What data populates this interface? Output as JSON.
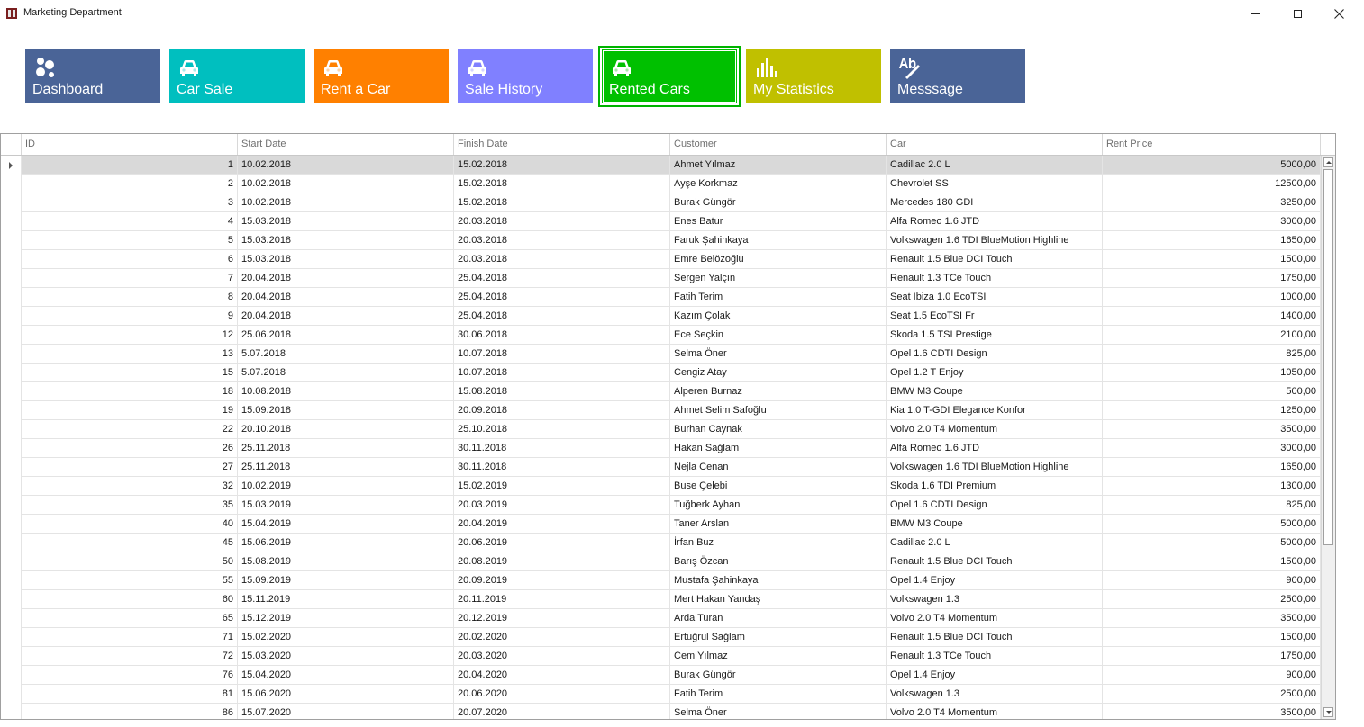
{
  "window": {
    "title": "Marketing Department",
    "controls": [
      "minimize",
      "maximize",
      "close"
    ]
  },
  "tiles": [
    {
      "label": "Dashboard",
      "icon": "bubbles-icon",
      "color": "#4a6497",
      "selected": false
    },
    {
      "label": "Car Sale",
      "icon": "car-icon",
      "color": "#00bfbf",
      "selected": false
    },
    {
      "label": "Rent a Car",
      "icon": "car-icon",
      "color": "#ff8000",
      "selected": false
    },
    {
      "label": "Sale History",
      "icon": "car-icon",
      "color": "#8080ff",
      "selected": false
    },
    {
      "label": "Rented Cars",
      "icon": "car-icon",
      "color": "#00c000",
      "selected": true
    },
    {
      "label": "My Statistics",
      "icon": "bar-chart-icon",
      "color": "#c0c000",
      "selected": false
    },
    {
      "label": "Messsage",
      "icon": "spell-check-icon",
      "color": "#4a6497",
      "selected": false
    }
  ],
  "grid": {
    "columns": [
      "ID",
      "Start Date",
      "Finish Date",
      "Customer",
      "Car",
      "Rent Price"
    ],
    "focused_row": 0,
    "rows": [
      [
        "1",
        "10.02.2018",
        "15.02.2018",
        "Ahmet Yılmaz",
        "Cadillac 2.0 L",
        "5000,00"
      ],
      [
        "2",
        "10.02.2018",
        "15.02.2018",
        "Ayşe Korkmaz",
        "Chevrolet SS",
        "12500,00"
      ],
      [
        "3",
        "10.02.2018",
        "15.02.2018",
        "Burak Güngör",
        "Mercedes 180 GDI",
        "3250,00"
      ],
      [
        "4",
        "15.03.2018",
        "20.03.2018",
        "Enes Batur",
        "Alfa Romeo 1.6 JTD",
        "3000,00"
      ],
      [
        "5",
        "15.03.2018",
        "20.03.2018",
        "Faruk Şahinkaya",
        "Volkswagen 1.6 TDI BlueMotion Highline",
        "1650,00"
      ],
      [
        "6",
        "15.03.2018",
        "20.03.2018",
        "Emre  Belözoğlu",
        "Renault 1.5 Blue DCI Touch",
        "1500,00"
      ],
      [
        "7",
        "20.04.2018",
        "25.04.2018",
        "Sergen Yalçın",
        "Renault 1.3 TCe Touch",
        "1750,00"
      ],
      [
        "8",
        "20.04.2018",
        "25.04.2018",
        "Fatih Terim",
        "Seat Ibiza 1.0 EcoTSI",
        "1000,00"
      ],
      [
        "9",
        "20.04.2018",
        "25.04.2018",
        "Kazım Çolak",
        "Seat 1.5 EcoTSI Fr",
        "1400,00"
      ],
      [
        "12",
        "25.06.2018",
        "30.06.2018",
        "Ece Seçkin",
        "Skoda 1.5 TSI Prestige",
        "2100,00"
      ],
      [
        "13",
        "5.07.2018",
        "10.07.2018",
        "Selma Öner",
        "Opel 1.6 CDTI Design",
        "825,00"
      ],
      [
        "15",
        "5.07.2018",
        "10.07.2018",
        "Cengiz Atay",
        "Opel 1.2 T Enjoy",
        "1050,00"
      ],
      [
        "18",
        "10.08.2018",
        "15.08.2018",
        "Alperen Burnaz",
        "BMW M3 Coupe",
        "500,00"
      ],
      [
        "19",
        "15.09.2018",
        "20.09.2018",
        "Ahmet Selim Safoğlu",
        "Kia 1.0 T-GDI Elegance Konfor",
        "1250,00"
      ],
      [
        "22",
        "20.10.2018",
        "25.10.2018",
        "Burhan Caynak",
        "Volvo 2.0 T4 Momentum",
        "3500,00"
      ],
      [
        "26",
        "25.11.2018",
        "30.11.2018",
        "Hakan Sağlam",
        "Alfa Romeo 1.6 JTD",
        "3000,00"
      ],
      [
        "27",
        "25.11.2018",
        "30.11.2018",
        "Nejla Cenan",
        "Volkswagen 1.6 TDI BlueMotion Highline",
        "1650,00"
      ],
      [
        "32",
        "10.02.2019",
        "15.02.2019",
        "Buse Çelebi",
        "Skoda 1.6 TDI Premium",
        "1300,00"
      ],
      [
        "35",
        "15.03.2019",
        "20.03.2019",
        "Tuğberk Ayhan",
        "Opel 1.6 CDTI Design",
        "825,00"
      ],
      [
        "40",
        "15.04.2019",
        "20.04.2019",
        "Taner Arslan",
        "BMW M3 Coupe",
        "5000,00"
      ],
      [
        "45",
        "15.06.2019",
        "20.06.2019",
        "İrfan Buz",
        "Cadillac 2.0 L",
        "5000,00"
      ],
      [
        "50",
        "15.08.2019",
        "20.08.2019",
        "Barış Özcan",
        "Renault 1.5 Blue DCI Touch",
        "1500,00"
      ],
      [
        "55",
        "15.09.2019",
        "20.09.2019",
        "Mustafa Şahinkaya",
        "Opel 1.4 Enjoy",
        "900,00"
      ],
      [
        "60",
        "15.11.2019",
        "20.11.2019",
        "Mert Hakan  Yandaş",
        "Volkswagen 1.3",
        "2500,00"
      ],
      [
        "65",
        "15.12.2019",
        "20.12.2019",
        "Arda Turan",
        "Volvo 2.0 T4 Momentum",
        "3500,00"
      ],
      [
        "71",
        "15.02.2020",
        "20.02.2020",
        "Ertuğrul Sağlam",
        "Renault 1.5 Blue DCI Touch",
        "1500,00"
      ],
      [
        "72",
        "15.03.2020",
        "20.03.2020",
        "Cem Yılmaz",
        "Renault 1.3 TCe Touch",
        "1750,00"
      ],
      [
        "76",
        "15.04.2020",
        "20.04.2020",
        "Burak Güngör",
        "Opel 1.4 Enjoy",
        "900,00"
      ],
      [
        "81",
        "15.06.2020",
        "20.06.2020",
        "Fatih Terim",
        "Volkswagen 1.3",
        "2500,00"
      ],
      [
        "86",
        "15.07.2020",
        "20.07.2020",
        "Selma Öner",
        "Volvo 2.0 T4 Momentum",
        "3500,00"
      ]
    ]
  }
}
